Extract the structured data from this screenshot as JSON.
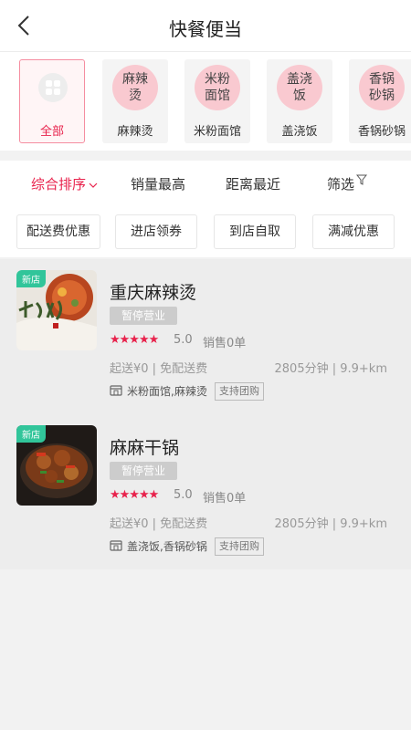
{
  "header": {
    "title": "快餐便当"
  },
  "categories": [
    {
      "label": "全部",
      "icon": "grid-icon",
      "active": true
    },
    {
      "label": "麻辣烫",
      "icon_text": "麻辣烫"
    },
    {
      "label": "米粉面馆",
      "icon_text": "米粉面馆"
    },
    {
      "label": "盖浇饭",
      "icon_text": "盖浇饭"
    },
    {
      "label": "香锅砂锅",
      "icon_text": "香锅砂锅"
    }
  ],
  "sort": {
    "composite": "综合排序",
    "sales": "销量最高",
    "distance": "距离最近",
    "filter": "筛选"
  },
  "tags": [
    "配送费优惠",
    "进店领券",
    "到店自取",
    "满减优惠"
  ],
  "shops": [
    {
      "badge": "新店",
      "name": "重庆麻辣烫",
      "status": "暂停营业",
      "stars": "★★★★★",
      "rating": "5.0",
      "sales": "销售0单",
      "delivery": "起送¥0 | 免配送费",
      "eta": "2805分钟 | 9.9+km",
      "categories": "米粉面馆,麻辣烫",
      "group": "支持团购"
    },
    {
      "badge": "新店",
      "name": "麻麻干锅",
      "status": "暂停营业",
      "stars": "★★★★★",
      "rating": "5.0",
      "sales": "销售0单",
      "delivery": "起送¥0 | 免配送费",
      "eta": "2805分钟 | 9.9+km",
      "categories": "盖浇饭,香锅砂锅",
      "group": "支持团购"
    }
  ],
  "colors": {
    "accent": "#e8224c",
    "badge": "#31c59a",
    "category_circle": "#f9c9d0"
  }
}
